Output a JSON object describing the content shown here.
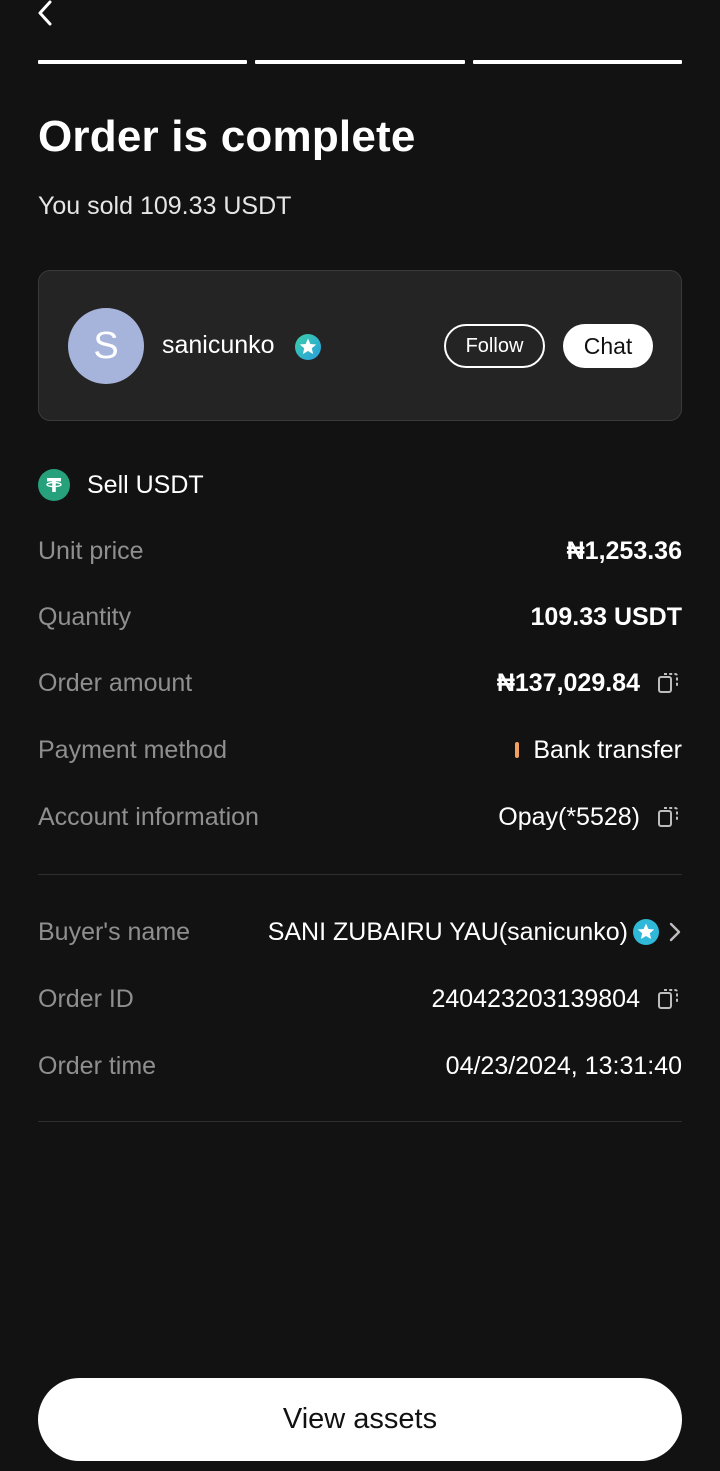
{
  "header": {
    "back_icon": "chevron-left-icon",
    "progress_steps": 3
  },
  "title": "Order is complete",
  "subtitle": "You sold 109.33 USDT",
  "user": {
    "initial": "S",
    "name": "sanicunko",
    "follow_label": "Follow",
    "chat_label": "Chat",
    "avatar_color": "#a6b4dc"
  },
  "order": {
    "sell_label": "Sell USDT",
    "coin_color": "#26a17b",
    "details": [
      {
        "label": "Unit price",
        "value": "₦1,253.36"
      },
      {
        "label": "Quantity",
        "value": "109.33 USDT"
      },
      {
        "label": "Order amount",
        "value": "₦137,029.84"
      },
      {
        "label": "Payment method",
        "value": "Bank transfer"
      },
      {
        "label": "Account information",
        "value": "Opay(*5528)"
      }
    ],
    "meta": [
      {
        "label": "Buyer's name",
        "value": "SANI ZUBAIRU YAU(sanicunko)"
      },
      {
        "label": "Order ID",
        "value": "240423203139804"
      },
      {
        "label": "Order time",
        "value": "04/23/2024, 13:31:40"
      }
    ]
  },
  "cta_label": "View assets",
  "colors": {
    "background": "#121212",
    "card": "#242424",
    "muted_text": "#8f8f8f",
    "payment_accent": "#f0a060",
    "verified_badge": "#2fb8d8"
  }
}
